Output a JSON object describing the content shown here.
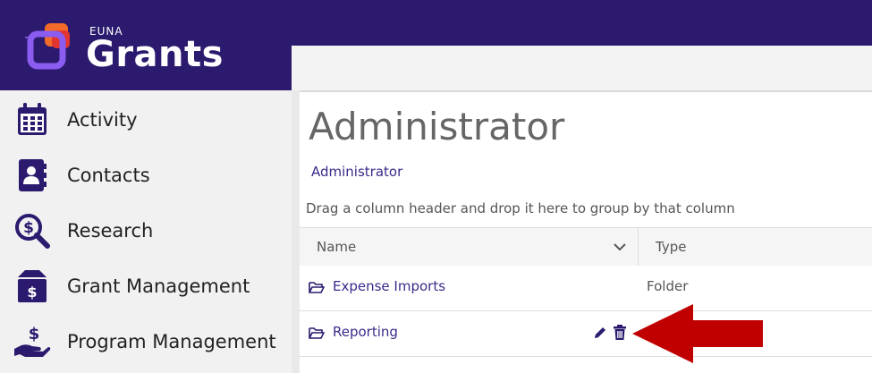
{
  "app": {
    "brand_small": "EUNA",
    "brand_large": "Grants"
  },
  "sidebar": {
    "items": [
      {
        "label": "Activity",
        "icon": "calendar-icon"
      },
      {
        "label": "Contacts",
        "icon": "contact-book-icon"
      },
      {
        "label": "Research",
        "icon": "dollar-search-icon"
      },
      {
        "label": "Grant Management",
        "icon": "money-box-icon"
      },
      {
        "label": "Program Management",
        "icon": "hand-dollar-icon"
      }
    ]
  },
  "main": {
    "title": "Administrator",
    "breadcrumb": "Administrator",
    "group_hint": "Drag a column header and drop it here to group by that column",
    "columns": {
      "name": "Name",
      "type": "Type"
    },
    "rows": [
      {
        "name": "Expense Imports",
        "type": "Folder"
      },
      {
        "name": "Reporting",
        "type": ""
      }
    ]
  },
  "colors": {
    "brand_purple": "#2b1a6e",
    "link": "#3b2a8a",
    "annotation_arrow": "#c00000",
    "logo_orange": "#f26b2a",
    "logo_violet": "#7b4fe0"
  }
}
